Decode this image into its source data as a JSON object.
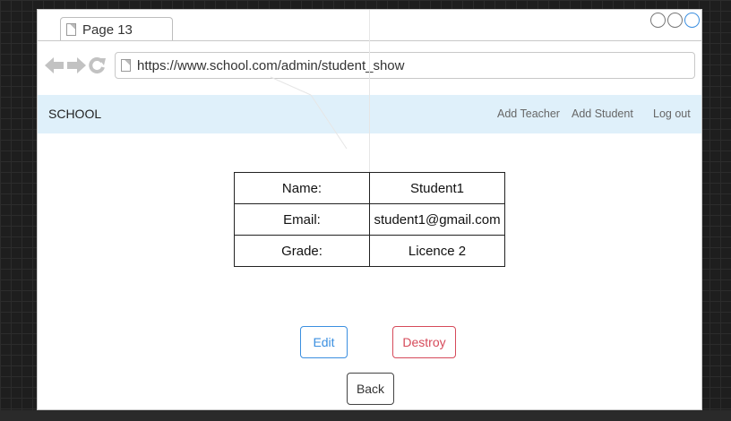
{
  "browser": {
    "tab_title": "Page 13",
    "url": "https://www.school.com/admin/student_show"
  },
  "navbar": {
    "brand": "SCHOOL",
    "links": [
      "Add Teacher",
      "Add Student",
      "Log out"
    ]
  },
  "student": {
    "rows": [
      {
        "label": "Name:",
        "value": "Student1"
      },
      {
        "label": "Email:",
        "value": "student1@gmail.com"
      },
      {
        "label": "Grade:",
        "value": "Licence 2"
      }
    ]
  },
  "actions": {
    "edit": "Edit",
    "destroy": "Destroy",
    "back": "Back"
  },
  "colors": {
    "navbar_bg": "#dff0fa",
    "edit": "#3b8fe0",
    "destroy": "#d64a5a"
  }
}
